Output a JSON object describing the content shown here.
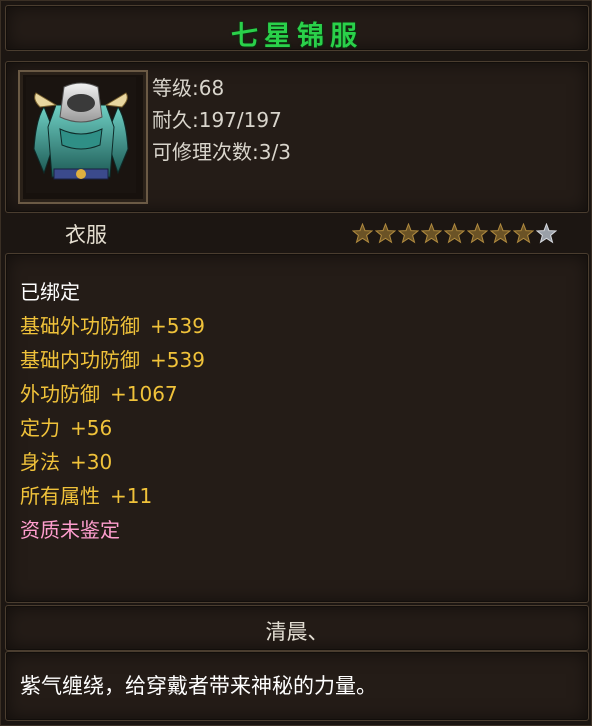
{
  "title": "七星锦服",
  "title_color": "#2ad14a",
  "item_icon": "armor-icon",
  "stats": {
    "level": "等级:68",
    "durability": "耐久:197/197",
    "repair": "可修理次数:3/3"
  },
  "item_type": "衣服",
  "stars": {
    "filled": 8,
    "total": 9
  },
  "attributes": [
    {
      "text": "已绑定",
      "color": "#ffffff"
    },
    {
      "name": "基础外功防御",
      "value": "+539",
      "color": "#f0c23a"
    },
    {
      "name": "基础内功防御",
      "value": "+539",
      "color": "#f0c23a"
    },
    {
      "name": "外功防御",
      "value": "+1067",
      "color": "#f0c23a"
    },
    {
      "name": "定力",
      "value": "+56",
      "color": "#f0c23a"
    },
    {
      "name": "身法",
      "value": "+30",
      "color": "#f0c23a"
    },
    {
      "name": "所有属性",
      "value": "+11",
      "color": "#f0c23a"
    },
    {
      "text": "资质未鉴定",
      "color": "#ff9ecf"
    }
  ],
  "owner": "清晨、",
  "description": "紫气缠绕，给穿戴者带来神秘的力量。"
}
